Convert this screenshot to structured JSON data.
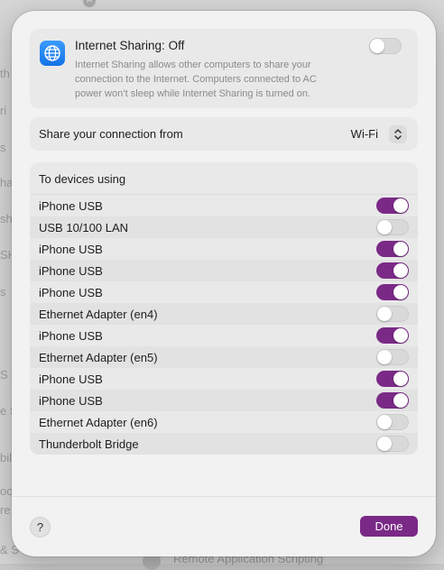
{
  "background": {
    "fragments": [
      "th",
      "ri",
      "s",
      "ha",
      "sh",
      "SH",
      "s",
      "S",
      "e S",
      "bil",
      "oo",
      "re",
      "& S"
    ],
    "bottom_text": "Remote Application Scripting"
  },
  "colors": {
    "accent": "#7a2a86",
    "icon_blue": "#1c80f0"
  },
  "sharing": {
    "icon": "globe-icon",
    "title": "Internet Sharing: Off",
    "description": "Internet Sharing allows other computers to share your connection to the Internet. Computers connected to AC power won’t sleep while Internet Sharing is turned on.",
    "enabled": false
  },
  "share_from": {
    "label": "Share your connection from",
    "value": "Wi-Fi"
  },
  "devices": {
    "header": "To devices using",
    "items": [
      {
        "name": "iPhone USB",
        "enabled": true
      },
      {
        "name": "USB 10/100 LAN",
        "enabled": false
      },
      {
        "name": "iPhone USB",
        "enabled": true
      },
      {
        "name": "iPhone USB",
        "enabled": true
      },
      {
        "name": "iPhone USB",
        "enabled": true
      },
      {
        "name": "Ethernet Adapter (en4)",
        "enabled": false
      },
      {
        "name": "iPhone USB",
        "enabled": true
      },
      {
        "name": "Ethernet Adapter (en5)",
        "enabled": false
      },
      {
        "name": "iPhone USB",
        "enabled": true
      },
      {
        "name": "iPhone USB",
        "enabled": true
      },
      {
        "name": "Ethernet Adapter (en6)",
        "enabled": false
      },
      {
        "name": "Thunderbolt Bridge",
        "enabled": false
      }
    ]
  },
  "footer": {
    "help_label": "?",
    "done_label": "Done"
  }
}
